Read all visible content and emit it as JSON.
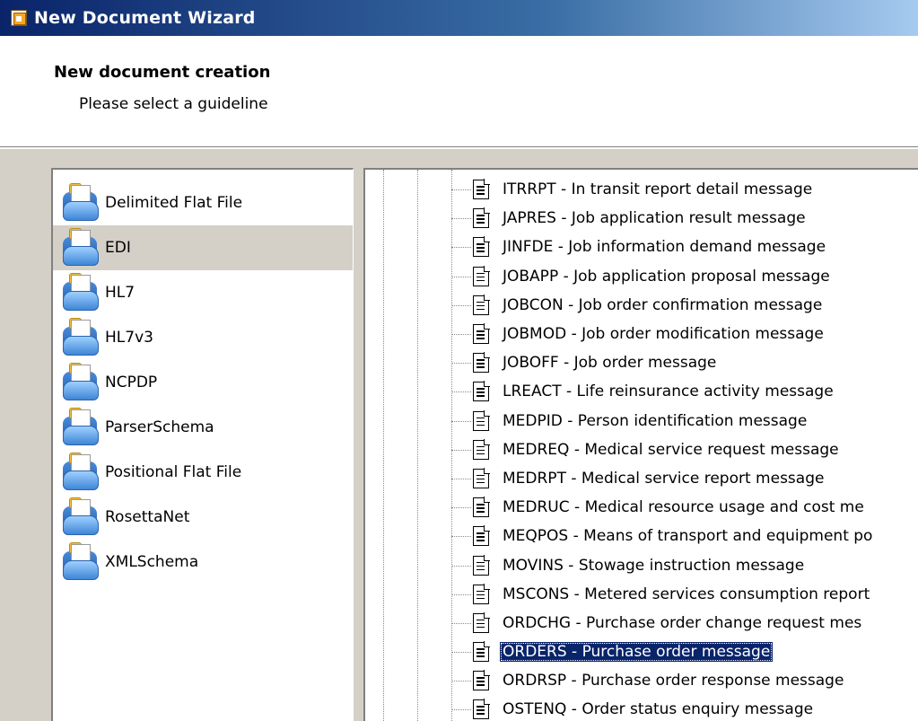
{
  "window": {
    "title": "New Document Wizard",
    "icon": "wizard-app-icon"
  },
  "header": {
    "title": "New document creation",
    "subtitle": "Please select a guideline"
  },
  "categories": {
    "selected_index": 1,
    "items": [
      {
        "label": "Delimited Flat File",
        "icon": "folder-icon"
      },
      {
        "label": "EDI",
        "icon": "folder-icon"
      },
      {
        "label": "HL7",
        "icon": "folder-icon"
      },
      {
        "label": "HL7v3",
        "icon": "folder-icon"
      },
      {
        "label": "NCPDP",
        "icon": "folder-icon"
      },
      {
        "label": "ParserSchema",
        "icon": "folder-icon"
      },
      {
        "label": "Positional Flat File",
        "icon": "folder-icon"
      },
      {
        "label": "RosettaNet",
        "icon": "folder-icon"
      },
      {
        "label": "XMLSchema",
        "icon": "folder-icon"
      }
    ]
  },
  "messages": {
    "selected_index": 17,
    "items": [
      {
        "label": "ITRRPT - In transit report detail message"
      },
      {
        "label": "JAPRES - Job application result message"
      },
      {
        "label": "JINFDE - Job information demand message"
      },
      {
        "label": "JOBAPP - Job application proposal message"
      },
      {
        "label": "JOBCON - Job order confirmation message"
      },
      {
        "label": "JOBMOD - Job order modification message"
      },
      {
        "label": "JOBOFF - Job order message"
      },
      {
        "label": "LREACT - Life reinsurance activity message"
      },
      {
        "label": "MEDPID - Person identification message"
      },
      {
        "label": "MEDREQ - Medical service request message"
      },
      {
        "label": "MEDRPT - Medical service report message"
      },
      {
        "label": "MEDRUC - Medical resource usage and cost me"
      },
      {
        "label": "MEQPOS - Means of transport and equipment po"
      },
      {
        "label": "MOVINS - Stowage instruction message"
      },
      {
        "label": "MSCONS - Metered services consumption report"
      },
      {
        "label": "ORDCHG - Purchase order change request mes"
      },
      {
        "label": "ORDERS - Purchase order message"
      },
      {
        "label": "ORDRSP - Purchase order response message"
      },
      {
        "label": "OSTENQ - Order status enquiry message"
      }
    ]
  },
  "colors": {
    "selection": "#0a246a",
    "titlebar_start": "#0a246a",
    "titlebar_end": "#a6caf0",
    "face": "#d4d0c8"
  }
}
